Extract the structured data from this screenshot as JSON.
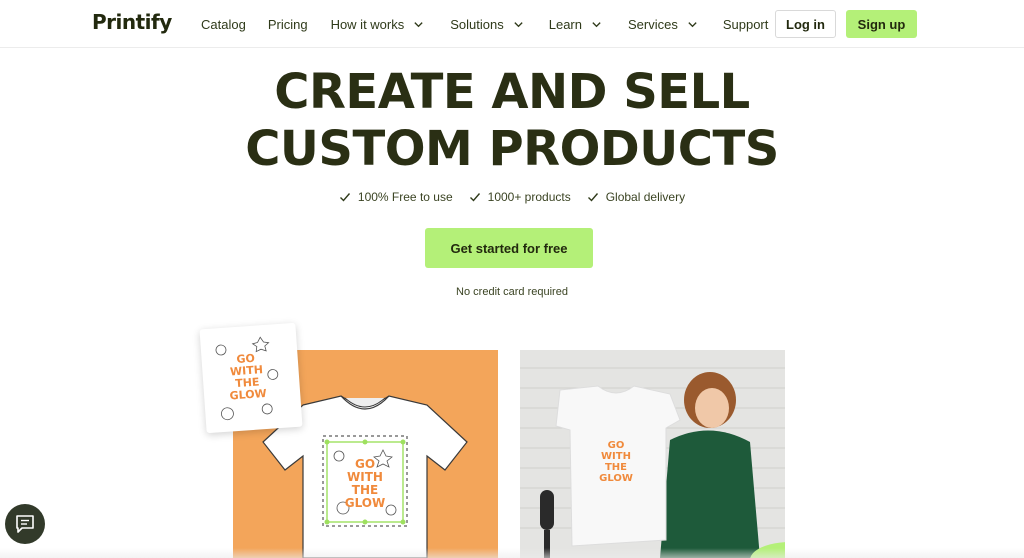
{
  "header": {
    "logo": "Printify",
    "nav": [
      {
        "label": "Catalog",
        "dropdown": false
      },
      {
        "label": "Pricing",
        "dropdown": false
      },
      {
        "label": "How it works",
        "dropdown": true
      },
      {
        "label": "Solutions",
        "dropdown": true
      },
      {
        "label": "Learn",
        "dropdown": true
      },
      {
        "label": "Services",
        "dropdown": true
      },
      {
        "label": "Support",
        "dropdown": true
      }
    ],
    "login_label": "Log in",
    "signup_label": "Sign up"
  },
  "hero": {
    "headline_line1": "CREATE AND SELL",
    "headline_line2": "CUSTOM PRODUCTS",
    "features": [
      "100% Free to use",
      "1000+ products",
      "Global delivery"
    ],
    "cta_label": "Get started for free",
    "note": "No credit card required"
  },
  "artwork": {
    "design_text": [
      "GO",
      "WITH",
      "THE",
      "GLOW"
    ]
  },
  "colors": {
    "accent_green": "#b4f078",
    "dark_text": "#2a2f14",
    "orange_bg": "#f3a55a",
    "design_orange": "#f08a3c"
  },
  "icons": {
    "check": "check-icon",
    "chevron": "chevron-down-icon",
    "chat": "chat-icon"
  }
}
